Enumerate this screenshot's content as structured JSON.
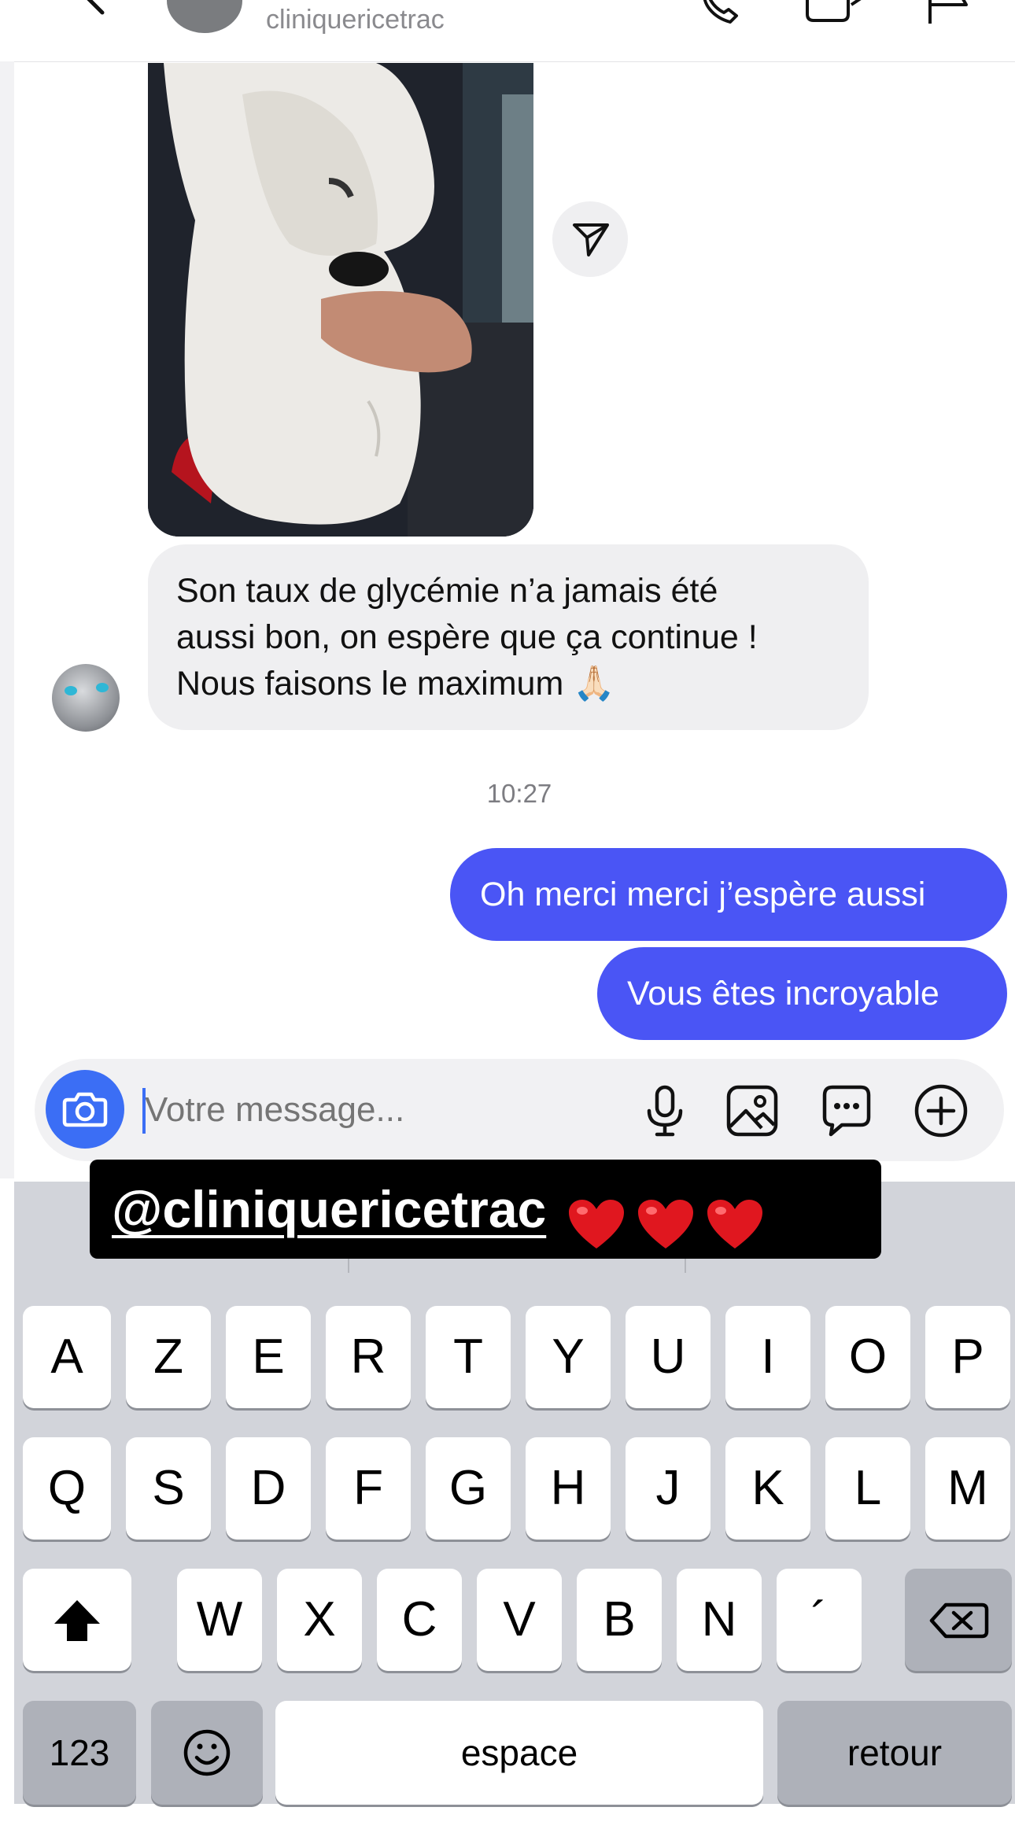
{
  "header": {
    "username": "cliniquericetrac"
  },
  "conversation": {
    "incoming_message": [
      "Son taux de glycémie n’a jamais été",
      "aussi bon, on espère que ça continue !",
      "Nous faisons le maximum 🙏🏻"
    ],
    "timestamp": "10:27",
    "outgoing_messages": [
      "Oh merci merci j’espère aussi",
      "Vous êtes incroyable"
    ]
  },
  "composer": {
    "placeholder": "Votre message..."
  },
  "sticker": {
    "mention": "@cliniquericetrac",
    "hearts": "❤️❤️❤️"
  },
  "keyboard": {
    "row_1": [
      "A",
      "Z",
      "E",
      "R",
      "T",
      "Y",
      "U",
      "I",
      "O",
      "P"
    ],
    "row_2": [
      "Q",
      "S",
      "D",
      "F",
      "G",
      "H",
      "J",
      "K",
      "L",
      "M"
    ],
    "row_3": [
      "W",
      "X",
      "C",
      "V",
      "B",
      "N",
      "´"
    ],
    "numbers_label": "123",
    "space_label": "espace",
    "return_label": "retour"
  },
  "colors": {
    "outgoing_bubble": "#4a55f5",
    "incoming_bubble": "#efeff1",
    "accent": "#3b6ef5",
    "keyboard_bg": "#d2d4da"
  },
  "icons": [
    "back-icon",
    "phone-icon",
    "video-camera-icon",
    "flag-icon",
    "send-icon",
    "camera-icon",
    "microphone-icon",
    "gallery-icon",
    "sticker-icon",
    "add-icon",
    "shift-icon",
    "delete-icon",
    "emoji-icon"
  ]
}
